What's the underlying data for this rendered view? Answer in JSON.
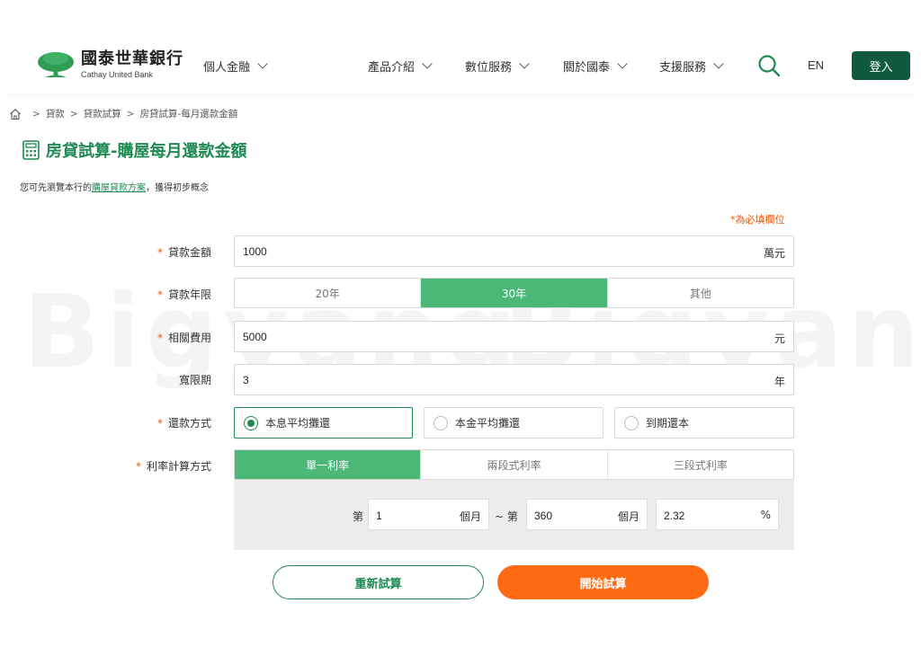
{
  "header": {
    "logo_cn": "國泰世華銀行",
    "logo_en": "Cathay United Bank",
    "personal_menu": "個人金融",
    "nav": [
      "產品介紹",
      "數位服務",
      "關於國泰",
      "支援服務"
    ],
    "lang": "EN",
    "login": "登入"
  },
  "breadcrumb": [
    "貸款",
    "貸款試算",
    "房貸試算-每月還款金額"
  ],
  "title": "房貸試算-購屋每月還款金額",
  "intro": {
    "before": "您可先瀏覽本行的",
    "link": "購屋貸款方案",
    "after": "，獲得初步概念"
  },
  "required_note": "*為必填欄位",
  "watermark": [
    "Bigyang",
    "Bigyang"
  ],
  "form": {
    "loan_amount": {
      "label": "貸款金額",
      "value": "1000",
      "unit": "萬元"
    },
    "loan_term": {
      "label": "貸款年限",
      "options": [
        "20年",
        "30年",
        "其他"
      ],
      "selected": "30年"
    },
    "fees": {
      "label": "相關費用",
      "value": "5000",
      "unit": "元"
    },
    "grace": {
      "label": "寬限期",
      "value": "3",
      "unit": "年"
    },
    "repay": {
      "label": "還款方式",
      "options": [
        "本息平均攤還",
        "本金平均攤還",
        "到期還本"
      ],
      "selected": "本息平均攤還"
    },
    "rate_mode": {
      "label": "利率計算方式",
      "options": [
        "單一利率",
        "兩段式利率",
        "三段式利率"
      ],
      "selected": "單一利率"
    },
    "rate": {
      "from_prefix": "第",
      "from_value": "1",
      "from_unit": "個月",
      "tilde": "~ 第",
      "to_value": "360",
      "to_unit": "個月",
      "rate_value": "2.32",
      "rate_unit": "%"
    }
  },
  "buttons": {
    "reset": "重新試算",
    "start": "開始試算"
  },
  "colors": {
    "brand_green": "#1e8a52",
    "active_green": "#4cb878",
    "login_bg": "#0f5b3b",
    "accent_orange": "#ff6a14",
    "required": "#e8590c"
  }
}
